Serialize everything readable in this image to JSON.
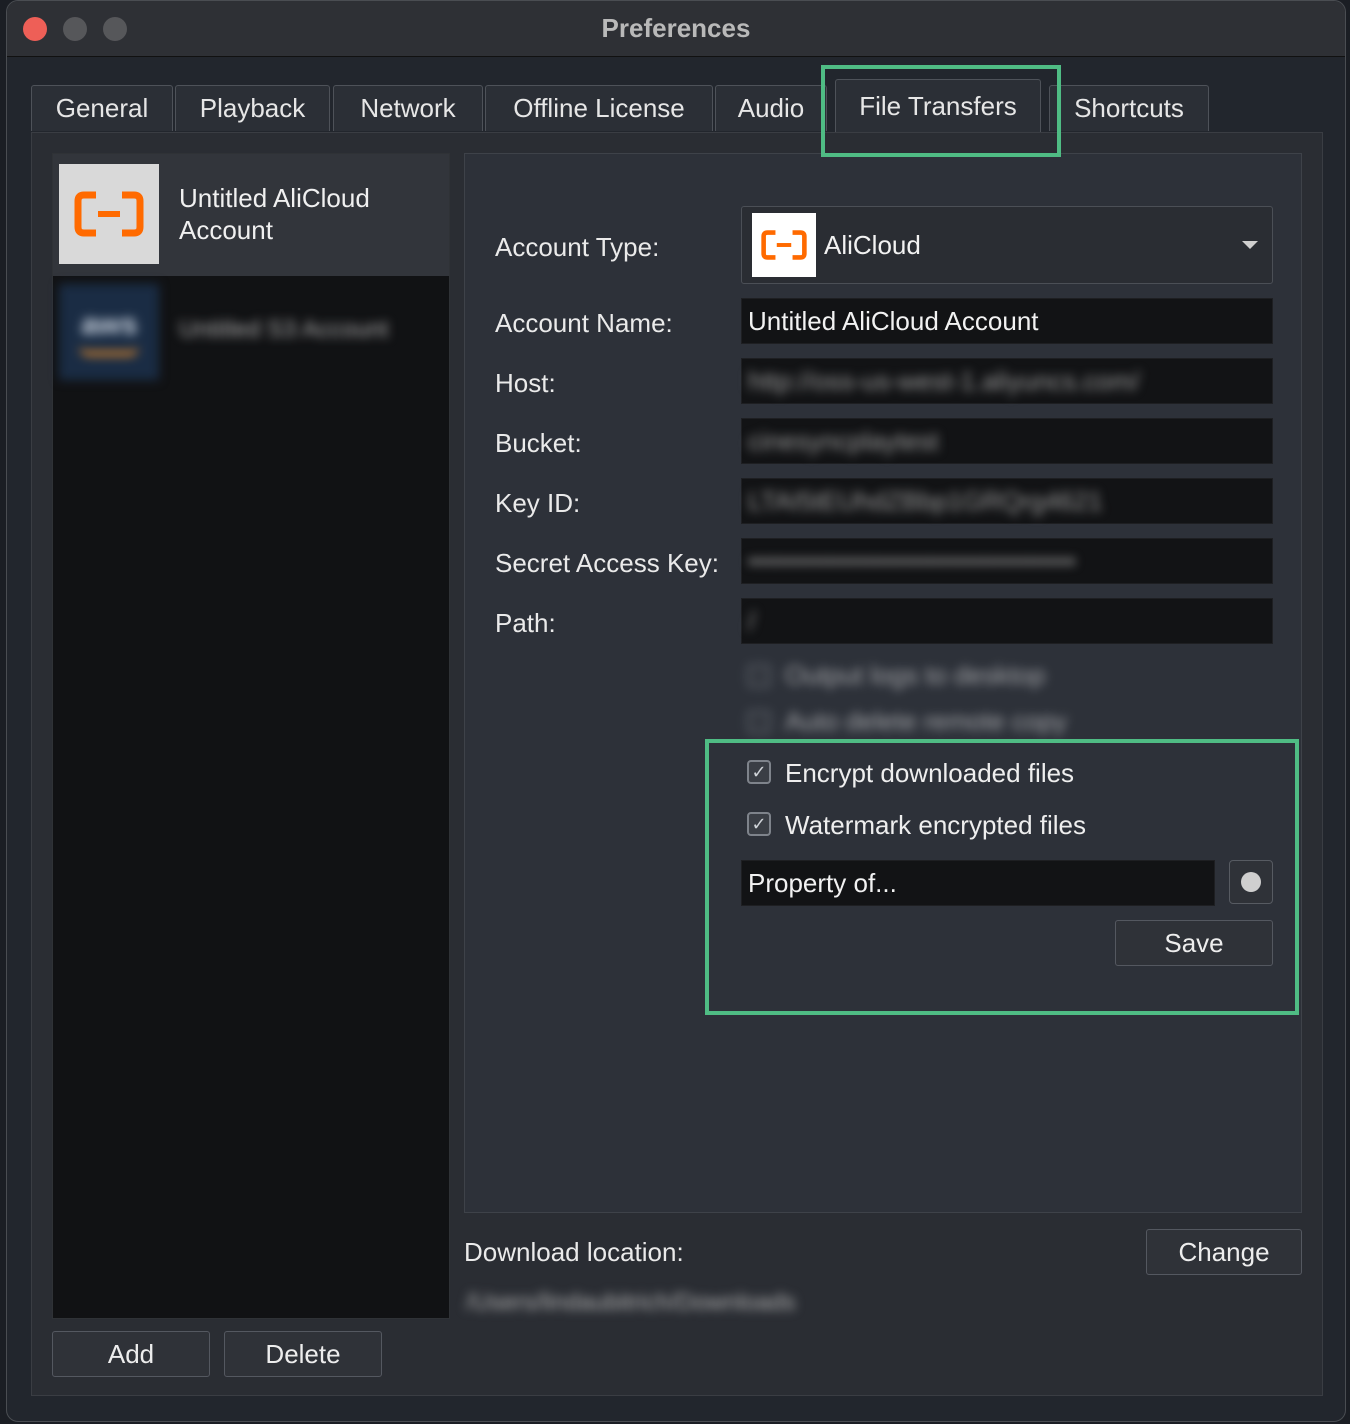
{
  "window": {
    "title": "Preferences"
  },
  "tabs": [
    {
      "label": "General"
    },
    {
      "label": "Playback"
    },
    {
      "label": "Network"
    },
    {
      "label": "Offline License"
    },
    {
      "label": "Audio"
    },
    {
      "label": "File Transfers",
      "active": true
    },
    {
      "label": "Shortcuts"
    }
  ],
  "accounts": [
    {
      "name": "Untitled AliCloud Account",
      "icon": "alicloud-logo",
      "selected": true
    },
    {
      "name": "Untitled S3 Account",
      "icon": "aws-logo",
      "blurred": true
    }
  ],
  "account_buttons": {
    "add": "Add",
    "delete": "Delete"
  },
  "form": {
    "account_type_label": "Account Type:",
    "account_type_value": "AliCloud",
    "account_name_label": "Account Name:",
    "account_name_value": "Untitled AliCloud Account",
    "host_label": "Host:",
    "host_value": "http://oss-us-west-1.aliyuncs.com/",
    "bucket_label": "Bucket:",
    "bucket_value": "cinesyncplaytest",
    "key_id_label": "Key ID:",
    "key_id_value": "LTAI5tEUhdZBbp1GRQrg4621",
    "secret_label": "Secret Access Key:",
    "secret_value": "••••••••••••••••••••••••••••••••••••",
    "path_label": "Path:",
    "path_value": "/",
    "output_logs_label": "Output logs to desktop",
    "auto_delete_label": "Auto delete remote copy",
    "encrypt_label": "Encrypt downloaded files",
    "encrypt_checked": true,
    "watermark_label": "Watermark encrypted files",
    "watermark_checked": true,
    "watermark_text": "Property of...",
    "save_label": "Save"
  },
  "download": {
    "label": "Download location:",
    "path": "/Users/lindaubitrich/Downloads",
    "change_label": "Change"
  },
  "colors": {
    "highlight": "#4fbc84",
    "alicloud_orange": "#ff6a00",
    "close": "#ee5f57"
  }
}
